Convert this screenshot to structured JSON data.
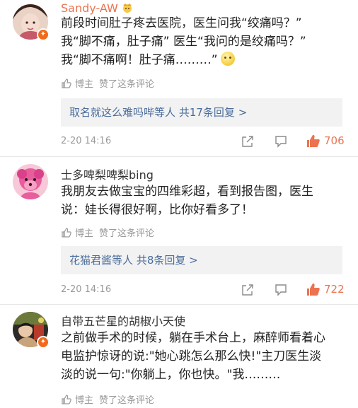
{
  "comments": [
    {
      "username": "Sandy-AW",
      "badge_emoji": "crown-emoji",
      "text_lines": [
        "前段时间肚子疼去医院，医生问我“绞痛吗？”",
        "我“脚不痛，肚子痛” 医生“我问的是绞痛吗？”",
        "我“脚不痛啊！肚子痛………”"
      ],
      "author_liked": {
        "blogger": "博主",
        "text": "赞了这条评论"
      },
      "replies": {
        "who": "取名就这么难吗哔",
        "middle": "等人",
        "count": "共17条回复",
        "arrow": ">"
      },
      "time": "2-20 14:16",
      "likes": "706",
      "verified": true
    },
    {
      "username": "士多啤梨啤梨bing",
      "text_lines": [
        "我朋友去做宝宝的四维彩超，看到报告图，医生",
        "说：娃长得很好啊，比你好看多了！"
      ],
      "author_liked": {
        "blogger": "博主",
        "text": "赞了这条评论"
      },
      "replies": {
        "who": "花猫君酱",
        "middle": "等人",
        "count": "共8条回复",
        "arrow": ">"
      },
      "time": "2-20 14:16",
      "likes": "722",
      "verified": false
    },
    {
      "username": "自带五芒星的胡椒小天使",
      "text_lines": [
        "之前做手术的时候，躺在手术台上，麻醉师看着心",
        "电监护惊讶的说:\"她心跳怎么那么快!\"主刀医生淡",
        "淡的说一句:\"你躺上，你也快。\"我………"
      ],
      "author_liked": {
        "blogger": "博主",
        "text": "赞了这条评论"
      },
      "verified": true
    }
  ],
  "colors": {
    "accent": "#eb7350",
    "link": "#4a6c9b",
    "muted": "#9a9a9a",
    "reply_bg": "#f2f2f2"
  }
}
